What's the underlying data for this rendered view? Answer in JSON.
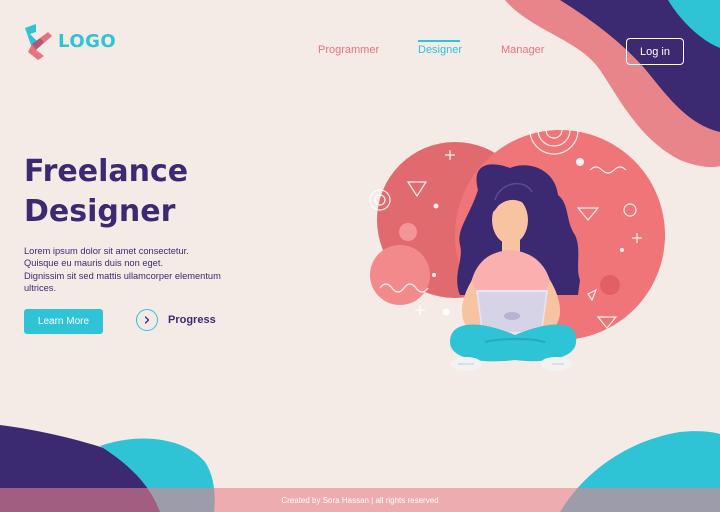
{
  "logo": {
    "text": "LOGO"
  },
  "nav": {
    "items": [
      {
        "label": "Programmer"
      },
      {
        "label": "Designer",
        "active": true
      },
      {
        "label": "Manager"
      }
    ],
    "login_label": "Log in"
  },
  "hero": {
    "title_line1": "Freelance",
    "title_line2": "Designer",
    "desc_lines": [
      "Lorem ipsum dolor sit amet consectetur.",
      "Quisque eu mauris duis non eget.",
      "Dignissim sit sed mattis ullamcorper elementum",
      "ultrices."
    ],
    "learn_more_label": "Learn More",
    "progress_label": "Progress"
  },
  "footer": {
    "text": "Created by Sora Hassan | all rights reserved"
  },
  "colors": {
    "background": "#f5ebe6",
    "accent_cyan": "#2fc3d6",
    "accent_pink": "#e8737e",
    "dark_purple": "#3b2a72"
  },
  "icons": [
    "logo-mark-icon",
    "chevron-right-icon"
  ]
}
